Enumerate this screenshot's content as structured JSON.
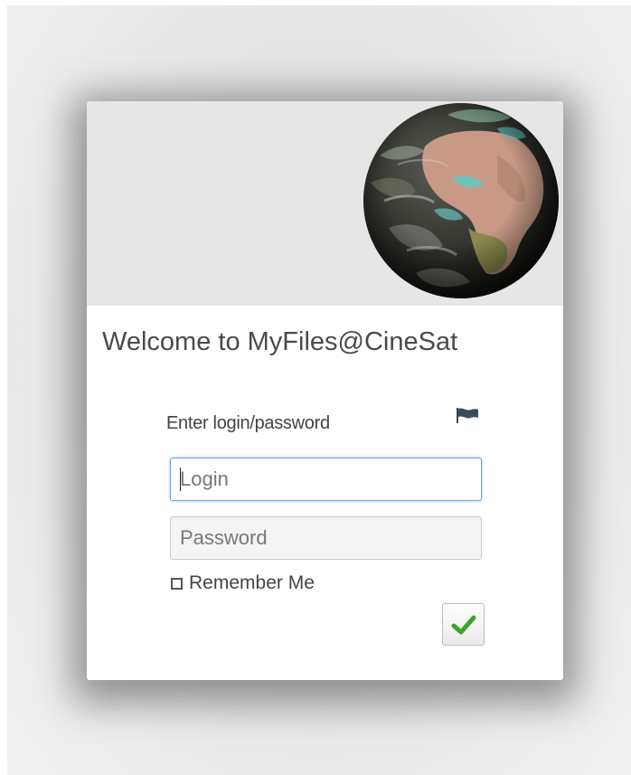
{
  "dialog": {
    "title": "Welcome to MyFiles@CineSat",
    "prompt": "Enter login/password",
    "login": {
      "value": "",
      "placeholder": "Login"
    },
    "password": {
      "value": "",
      "placeholder": "Password"
    },
    "remember_label": "Remember Me",
    "remember_checked": false,
    "header_image": "earth-globe-icon",
    "language_icon": "flag-icon",
    "submit_icon": "checkmark-icon"
  },
  "colors": {
    "header_bg": "#e6e6e6",
    "focus_border": "#6ea3dc",
    "check_green": "#3aa52c",
    "title_text": "#4a4a4a"
  }
}
